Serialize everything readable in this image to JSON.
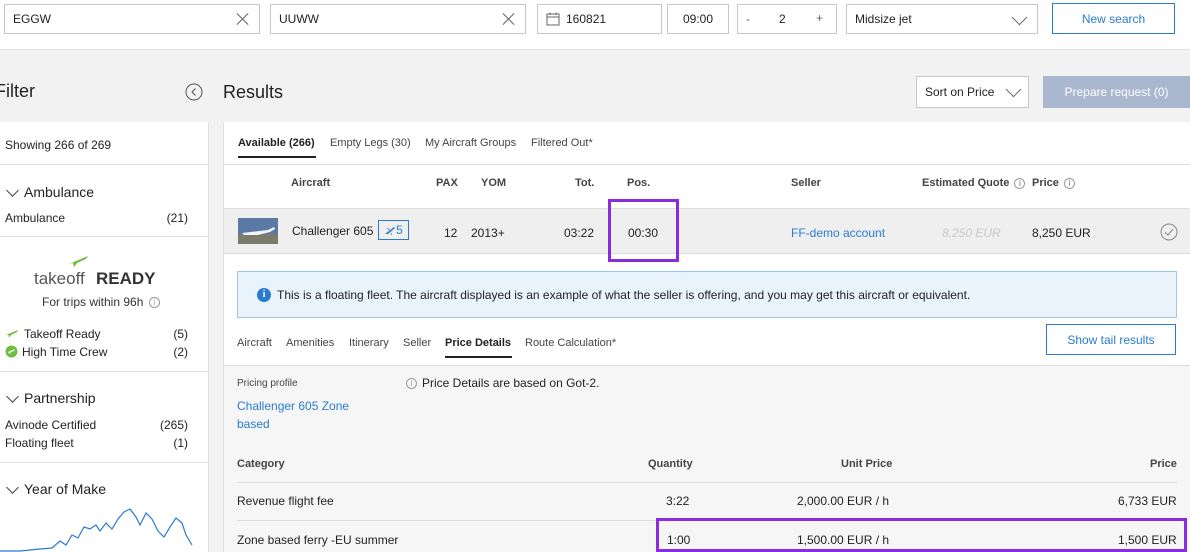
{
  "search": {
    "from": "EGGW",
    "to": "UUWW",
    "date": "160821",
    "time": "09:00",
    "pax_minus": "-",
    "pax": "2",
    "pax_plus": "+",
    "aircraft_class": "Midsize jet",
    "new_search_label": "New search"
  },
  "filter": {
    "title": "Filter",
    "showing": "Showing 266 of 269",
    "ambulance": {
      "heading": "Ambulance",
      "items": [
        {
          "label": "Ambulance",
          "count": "(21)"
        }
      ]
    },
    "takeoff": {
      "logo_text_light": "takeoff",
      "logo_text_bold": "READY",
      "subtitle": "For trips within 96h",
      "items": [
        {
          "label": "Takeoff Ready",
          "count": "(5)"
        },
        {
          "label": "High Time Crew",
          "count": "(2)"
        }
      ]
    },
    "partnership": {
      "heading": "Partnership",
      "items": [
        {
          "label": "Avinode Certified",
          "count": "(265)"
        },
        {
          "label": "Floating fleet",
          "count": "(1)"
        }
      ]
    },
    "year_of_make": {
      "heading": "Year of Make"
    }
  },
  "results": {
    "title": "Results",
    "sort_label": "Sort on Price",
    "prepare_label": "Prepare request (0)",
    "tabs": [
      "Available (266)",
      "Empty Legs (30)",
      "My Aircraft Groups",
      "Filtered Out*"
    ],
    "columns": {
      "aircraft": "Aircraft",
      "pax": "PAX",
      "yom": "YOM",
      "tot": "Tot.",
      "pos": "Pos.",
      "seller": "Seller",
      "estimated_quote": "Estimated Quote",
      "price": "Price"
    },
    "row": {
      "aircraft": "Challenger 605",
      "badge": "5",
      "pax": "12",
      "yom": "2013+",
      "tot": "03:22",
      "pos": "00:30",
      "seller": "FF-demo account",
      "estimated_quote": "8,250 EUR",
      "price": "8,250 EUR"
    },
    "info": "This is a floating fleet. The aircraft displayed is an example of what the seller is offering, and you may get this aircraft or equivalent.",
    "subtabs": [
      "Aircraft",
      "Amenities",
      "Itinerary",
      "Seller",
      "Price Details",
      "Route Calculation*"
    ],
    "active_subtab": "Price Details",
    "show_tail_label": "Show tail results",
    "price_details": {
      "pricing_profile_label": "Pricing profile",
      "pricing_profile_link_1": "Challenger 605 Zone",
      "pricing_profile_link_2": "based",
      "note": "Price Details are based on Got-2.",
      "headers": {
        "category": "Category",
        "quantity": "Quantity",
        "unit_price": "Unit Price",
        "price": "Price"
      },
      "rows": [
        {
          "category": "Revenue flight fee",
          "quantity": "3:22",
          "unit_price": "2,000.00 EUR / h",
          "price": "6,733 EUR"
        },
        {
          "category": "Zone based ferry -EU summer",
          "quantity": "1:00",
          "unit_price": "1,500.00 EUR / h",
          "price": "1,500 EUR"
        }
      ]
    }
  },
  "colors": {
    "accent": "#2a7bd0",
    "highlight": "#8a2be2",
    "disabled_button": "#a9b8cf",
    "takeoff_green": "#6dbf3e"
  }
}
